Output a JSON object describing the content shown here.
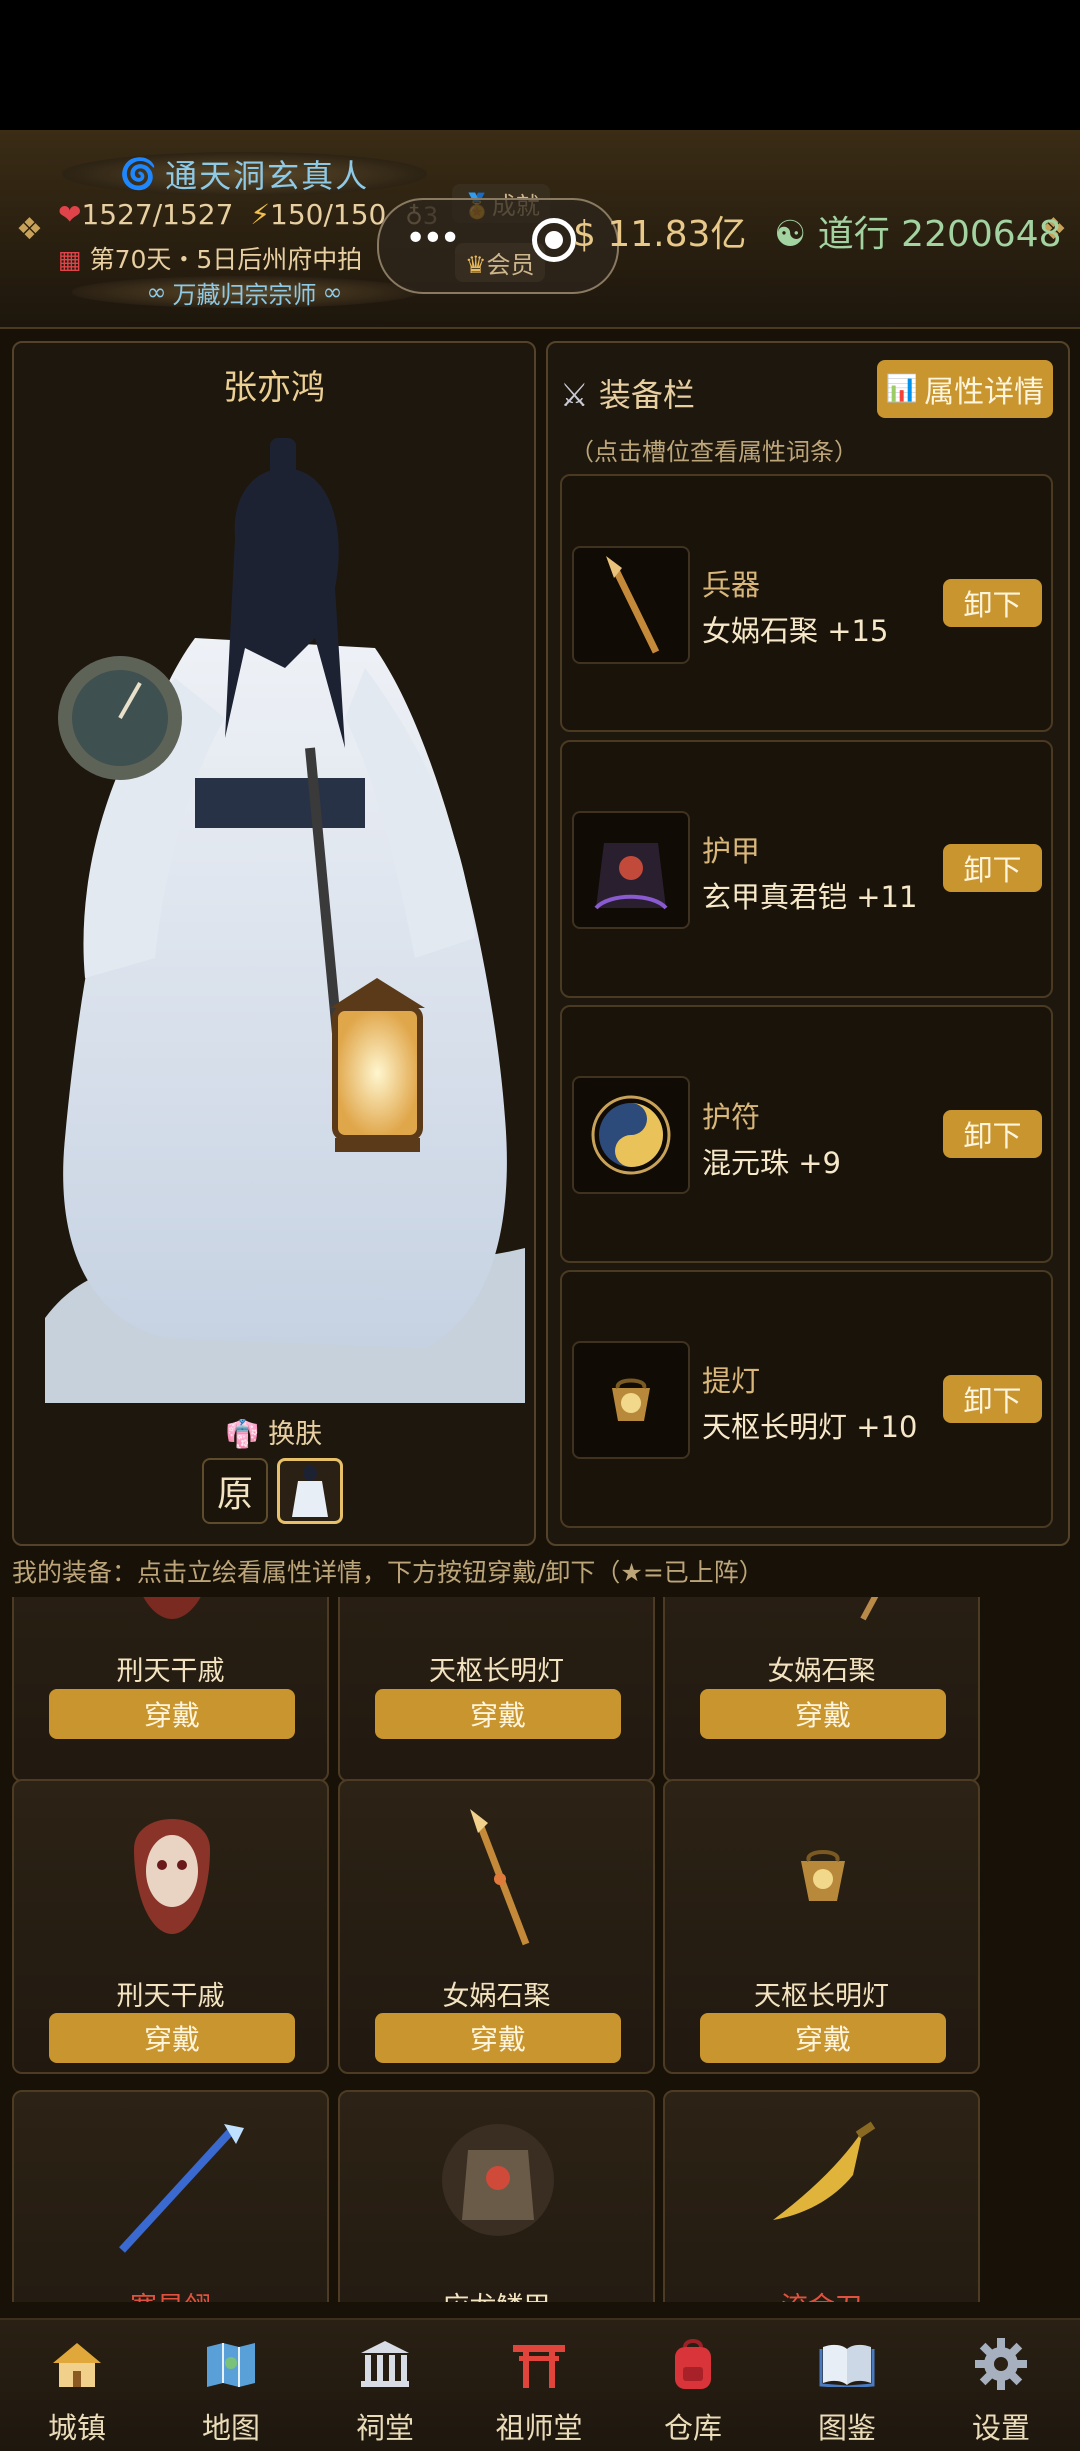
{
  "header": {
    "title": "通天洞玄真人",
    "hp": "1527/1527",
    "energy": "150/150",
    "badge_count": "3",
    "date": "第70天・5日后州府中拍",
    "sect": "万藏归宗宗师",
    "achievement_label": "成就",
    "member_label": "会员",
    "money": "$ 11.83亿",
    "daoxing": "道行 2200648"
  },
  "character": {
    "name": "张亦鸿",
    "skin_label": "换肤",
    "skin_original": "原"
  },
  "equipment": {
    "title": "装备栏",
    "attr_button": "属性详情",
    "hint": "（点击槽位查看属性词条）",
    "unequip_label": "卸下",
    "slots": [
      {
        "type": "兵器",
        "name": "女娲石棸 +15",
        "icon": "spear-icon"
      },
      {
        "type": "护甲",
        "name": "玄甲真君铠 +11",
        "icon": "armor-icon"
      },
      {
        "type": "护符",
        "name": "混元珠 +9",
        "icon": "taiji-amulet-icon"
      },
      {
        "type": "提灯",
        "name": "天枢长明灯 +10",
        "icon": "lantern-icon"
      }
    ]
  },
  "inventory": {
    "hint": "我的装备：点击立绘看属性详情，下方按钮穿戴/卸下（★=已上阵）",
    "wear_label": "穿戴",
    "items": [
      {
        "name": "刑天干戚",
        "icon": "mask-icon"
      },
      {
        "name": "天枢长明灯",
        "icon": "lantern-icon"
      },
      {
        "name": "女娲石棸",
        "icon": "spear-icon"
      },
      {
        "name": "刑天干戚",
        "icon": "mask-icon"
      },
      {
        "name": "女娲石棸",
        "icon": "spear-icon"
      },
      {
        "name": "天枢长明灯",
        "icon": "lantern-icon"
      },
      {
        "name": "寒星翎",
        "icon": "blue-spear-icon"
      },
      {
        "name": "应龙鳞甲",
        "icon": "armor-icon"
      },
      {
        "name": "流金刀",
        "icon": "golden-blade-icon"
      }
    ]
  },
  "nav": [
    {
      "label": "城镇",
      "icon": "town-icon"
    },
    {
      "label": "地图",
      "icon": "map-icon"
    },
    {
      "label": "祠堂",
      "icon": "temple-icon"
    },
    {
      "label": "祖师堂",
      "icon": "torii-icon"
    },
    {
      "label": "仓库",
      "icon": "backpack-icon"
    },
    {
      "label": "图鉴",
      "icon": "book-icon"
    },
    {
      "label": "设置",
      "icon": "gear-icon"
    }
  ],
  "colors": {
    "accent": "#c8952e",
    "background": "#171108",
    "title_blue": "#8ec9e6",
    "daoxing_green": "#a3d3a0",
    "rare_red": "#e0523d"
  }
}
